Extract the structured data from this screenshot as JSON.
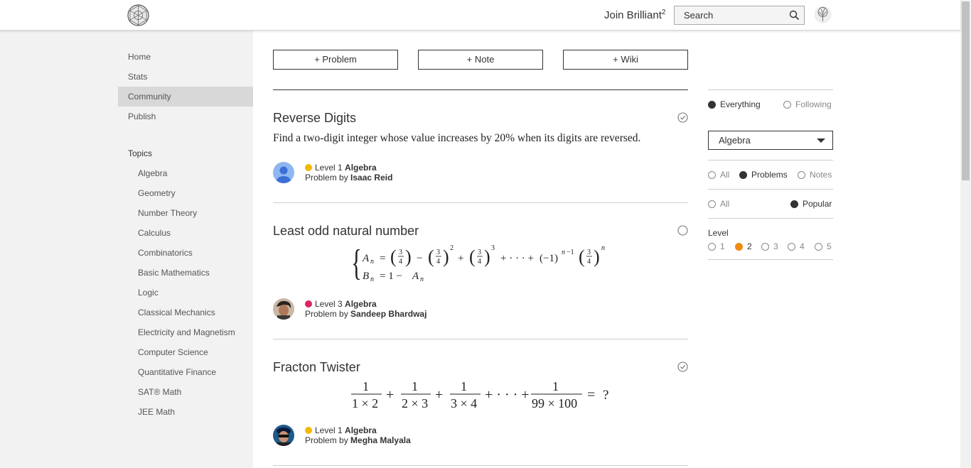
{
  "header": {
    "join_label": "Join Brilliant",
    "join_sup": "2",
    "search_placeholder": "Search"
  },
  "sidebar": {
    "nav": [
      {
        "label": "Home"
      },
      {
        "label": "Stats"
      },
      {
        "label": "Community",
        "active": true
      },
      {
        "label": "Publish"
      }
    ],
    "topics_label": "Topics",
    "topics": [
      "Algebra",
      "Geometry",
      "Number Theory",
      "Calculus",
      "Combinatorics",
      "Basic Mathematics",
      "Logic",
      "Classical Mechanics",
      "Electricity and Magnetism",
      "Computer Science",
      "Quantitative Finance",
      "SAT® Math",
      "JEE Math"
    ]
  },
  "actions": {
    "problem": "+ Problem",
    "note": "+ Note",
    "wiki": "+ Wiki"
  },
  "feed": [
    {
      "title": "Reverse Digits",
      "text": "Find a two-digit integer whose value increases by 20% when its digits are reversed.",
      "level_label": "Level 1",
      "level_color": "#f5b800",
      "topic": "Algebra",
      "by_label": "Problem by",
      "author": "Isaac Reid",
      "status_icon": "check-circle-icon"
    },
    {
      "title": "Least odd natural number",
      "level_label": "Level 3",
      "level_color": "#e0245e",
      "topic": "Algebra",
      "by_label": "Problem by",
      "author": "Sandeep Bhardwaj",
      "status_icon": "empty-circle-icon"
    },
    {
      "title": "Fracton Twister",
      "level_label": "Level 1",
      "level_color": "#f5b800",
      "topic": "Algebra",
      "by_label": "Problem by",
      "author": "Megha Malyala",
      "status_icon": "check-circle-icon"
    }
  ],
  "filters": {
    "scope": {
      "options": [
        "Everything",
        "Following"
      ],
      "selected": "Everything"
    },
    "topic_select": "Algebra",
    "type": {
      "options": [
        "All",
        "Problems",
        "Notes"
      ],
      "selected": "Problems"
    },
    "sort": {
      "options": [
        "All",
        "Popular"
      ],
      "selected": "Popular"
    },
    "level_label": "Level",
    "levels": {
      "options": [
        "1",
        "2",
        "3",
        "4",
        "5"
      ],
      "selected": "2"
    }
  },
  "colors": {
    "accent": "#f08b12",
    "dark": "#333333"
  }
}
